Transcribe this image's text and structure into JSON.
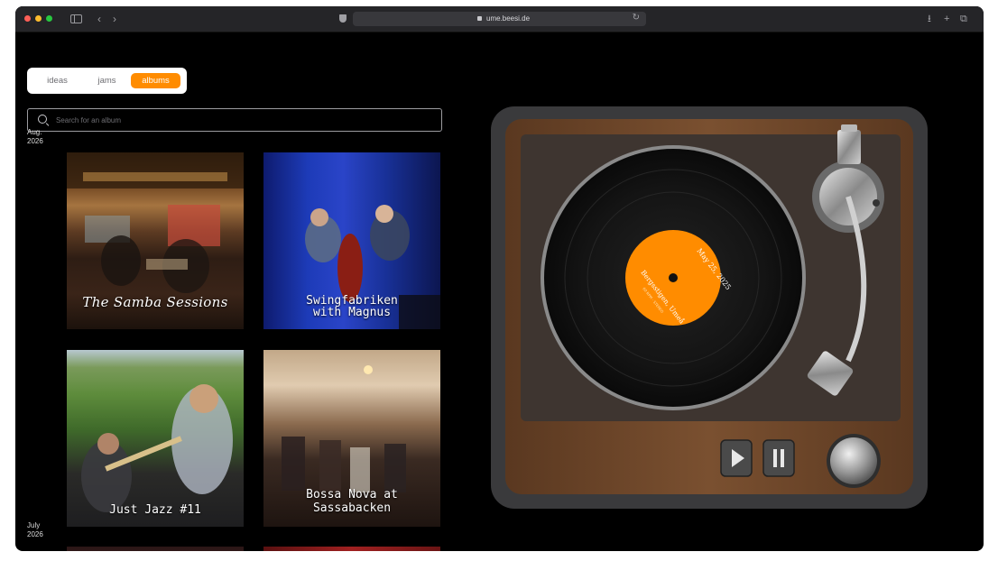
{
  "browser": {
    "url": "ume.beesi.de"
  },
  "tabs": {
    "ideas": "ideas",
    "jams": "jams",
    "albums": "albums",
    "active": "albums"
  },
  "search": {
    "placeholder": "Search for an album",
    "value": ""
  },
  "groups": [
    {
      "month": "Aug.",
      "year": "2026",
      "albums": [
        {
          "title": "The Samba Sessions"
        },
        {
          "title_line1": "Swingfabriken",
          "title_line2": "with  Magnus"
        },
        {
          "title": "Just Jazz #11"
        },
        {
          "title_line1": "Bossa Nova at",
          "title_line2": "Sassabacken"
        }
      ]
    },
    {
      "month": "July",
      "year": "2026"
    }
  ],
  "player": {
    "label_date": "May 25, 2025",
    "label_place": "Bergsstigen, Umeå",
    "label_small": "60 RPM · STEREO"
  },
  "colors": {
    "accent": "#ff8c00",
    "background": "#000000",
    "wood": "#6b4426"
  },
  "icons": [
    "sidebar-icon",
    "back-icon",
    "forward-icon",
    "shield-icon",
    "lock-icon",
    "reload-icon",
    "download-icon",
    "plus-icon",
    "tabs-icon",
    "search-icon",
    "play-icon",
    "pause-icon",
    "volume-knob-icon"
  ]
}
